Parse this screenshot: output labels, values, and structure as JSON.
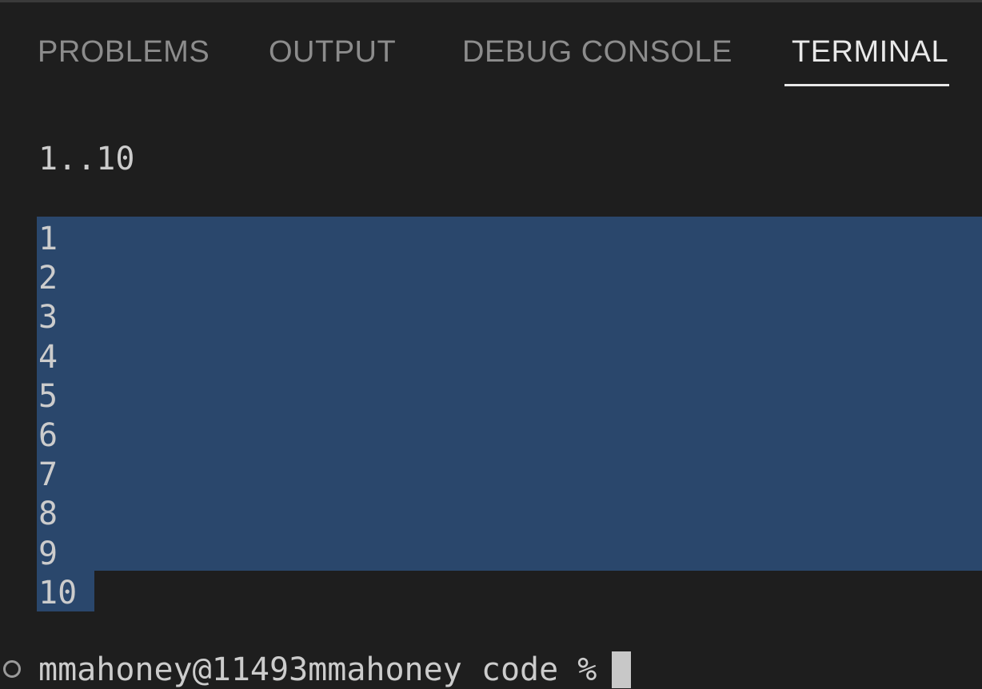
{
  "tabs": [
    {
      "label": "PROBLEMS",
      "active": false
    },
    {
      "label": "OUTPUT",
      "active": false
    },
    {
      "label": "DEBUG CONSOLE",
      "active": false
    },
    {
      "label": "TERMINAL",
      "active": true
    }
  ],
  "terminal": {
    "command_echo": "1..10",
    "output": [
      "1",
      "2",
      "3",
      "4",
      "5",
      "6",
      "7",
      "8",
      "9",
      "10"
    ],
    "prompt": "mmahoney@11493mmahoney code %",
    "selection_color": "#2a476c"
  },
  "colors": {
    "background": "#1e1e1e",
    "tab_inactive": "#8c8c8c",
    "tab_active": "#e8e8e8",
    "text": "#cccccc"
  }
}
